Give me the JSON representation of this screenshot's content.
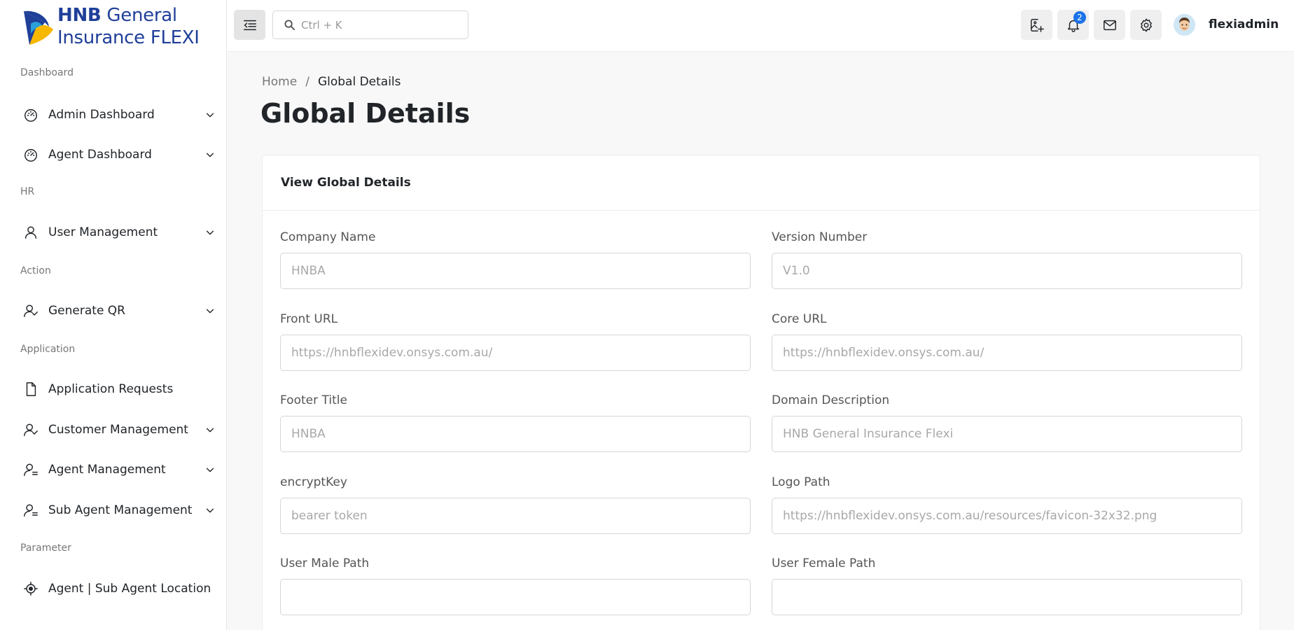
{
  "brand": {
    "name_bold": "HNB",
    "name_rest_line1": " General",
    "name_line2": "Insurance FLEXI"
  },
  "sidebar": {
    "sections": [
      {
        "label": "Dashboard"
      },
      {
        "label": "HR"
      },
      {
        "label": "Action"
      },
      {
        "label": "Application"
      },
      {
        "label": "Parameter"
      }
    ],
    "items": [
      {
        "label": "Admin Dashboard",
        "icon": "dashboard-icon",
        "expandable": true
      },
      {
        "label": "Agent Dashboard",
        "icon": "dashboard-icon",
        "expandable": true
      },
      {
        "label": "User Management",
        "icon": "user-icon",
        "expandable": true
      },
      {
        "label": "Generate QR",
        "icon": "users-icon",
        "expandable": true
      },
      {
        "label": "Application Requests",
        "icon": "file-icon",
        "expandable": false
      },
      {
        "label": "Customer Management",
        "icon": "users-icon",
        "expandable": true
      },
      {
        "label": "Agent Management",
        "icon": "user-list-icon",
        "expandable": true
      },
      {
        "label": "Sub Agent Management",
        "icon": "user-list-icon",
        "expandable": true
      },
      {
        "label": "Agent | Sub Agent Location",
        "icon": "crosshair-icon",
        "expandable": false
      }
    ]
  },
  "topbar": {
    "search_placeholder": "Ctrl + K",
    "notification_count": "2",
    "username": "flexiadmin"
  },
  "breadcrumb": {
    "home": "Home",
    "separator": "/",
    "current": "Global Details"
  },
  "page_title": "Global Details",
  "card": {
    "title": "View Global Details",
    "fields": [
      {
        "label": "Company Name",
        "placeholder": "HNBA",
        "value": ""
      },
      {
        "label": "Version Number",
        "placeholder": "V1.0",
        "value": ""
      },
      {
        "label": "Front URL",
        "placeholder": "https://hnbflexidev.onsys.com.au/",
        "value": ""
      },
      {
        "label": "Core URL",
        "placeholder": "https://hnbflexidev.onsys.com.au/",
        "value": ""
      },
      {
        "label": "Footer Title",
        "placeholder": "HNBA",
        "value": ""
      },
      {
        "label": "Domain Description",
        "placeholder": "HNB General Insurance Flexi",
        "value": ""
      },
      {
        "label": "encryptKey",
        "placeholder": "bearer token",
        "value": ""
      },
      {
        "label": "Logo Path",
        "placeholder": "https://hnbflexidev.onsys.com.au/resources/favicon-32x32.png",
        "value": ""
      },
      {
        "label": "User Male Path",
        "placeholder": "",
        "value": ""
      },
      {
        "label": "User Female Path",
        "placeholder": "",
        "value": ""
      }
    ]
  },
  "colors": {
    "brand_blue": "#1f3f99",
    "brand_yellow": "#f6b800",
    "badge_blue": "#1a73e8",
    "page_bg": "#f8f8f8"
  }
}
